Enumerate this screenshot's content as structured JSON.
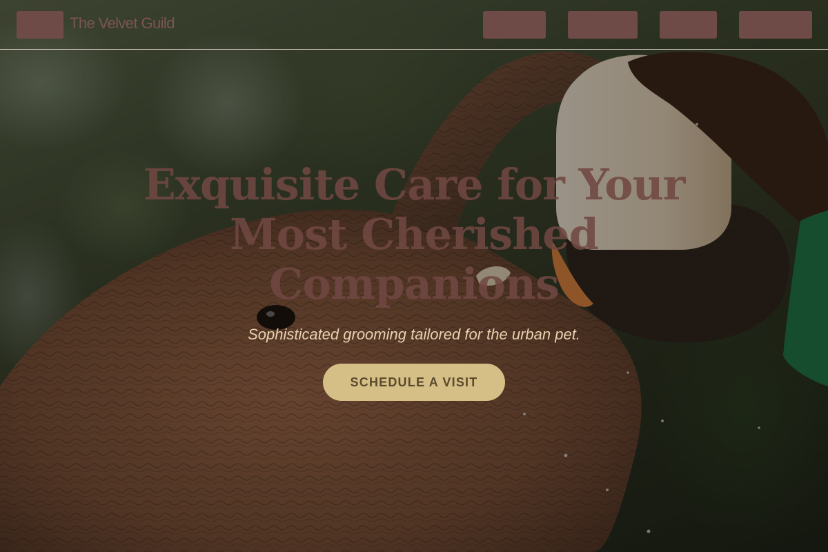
{
  "header": {
    "brand_name": "The Velvet Guild",
    "nav": [
      {
        "label": ""
      },
      {
        "label": ""
      },
      {
        "label": ""
      },
      {
        "label": ""
      }
    ]
  },
  "hero": {
    "title": "Exquisite Care for Your Most Cherished Companions",
    "subtitle": "Sophisticated grooming tailored for the urban pet.",
    "cta_label": "SCHEDULE A VISIT"
  },
  "colors": {
    "nav_fill": "#6e4b47",
    "title_color": "#704842",
    "cta_background": "#d5bf86",
    "cta_text": "#5a4a2c",
    "subtitle_color": "#e7d2b0"
  }
}
